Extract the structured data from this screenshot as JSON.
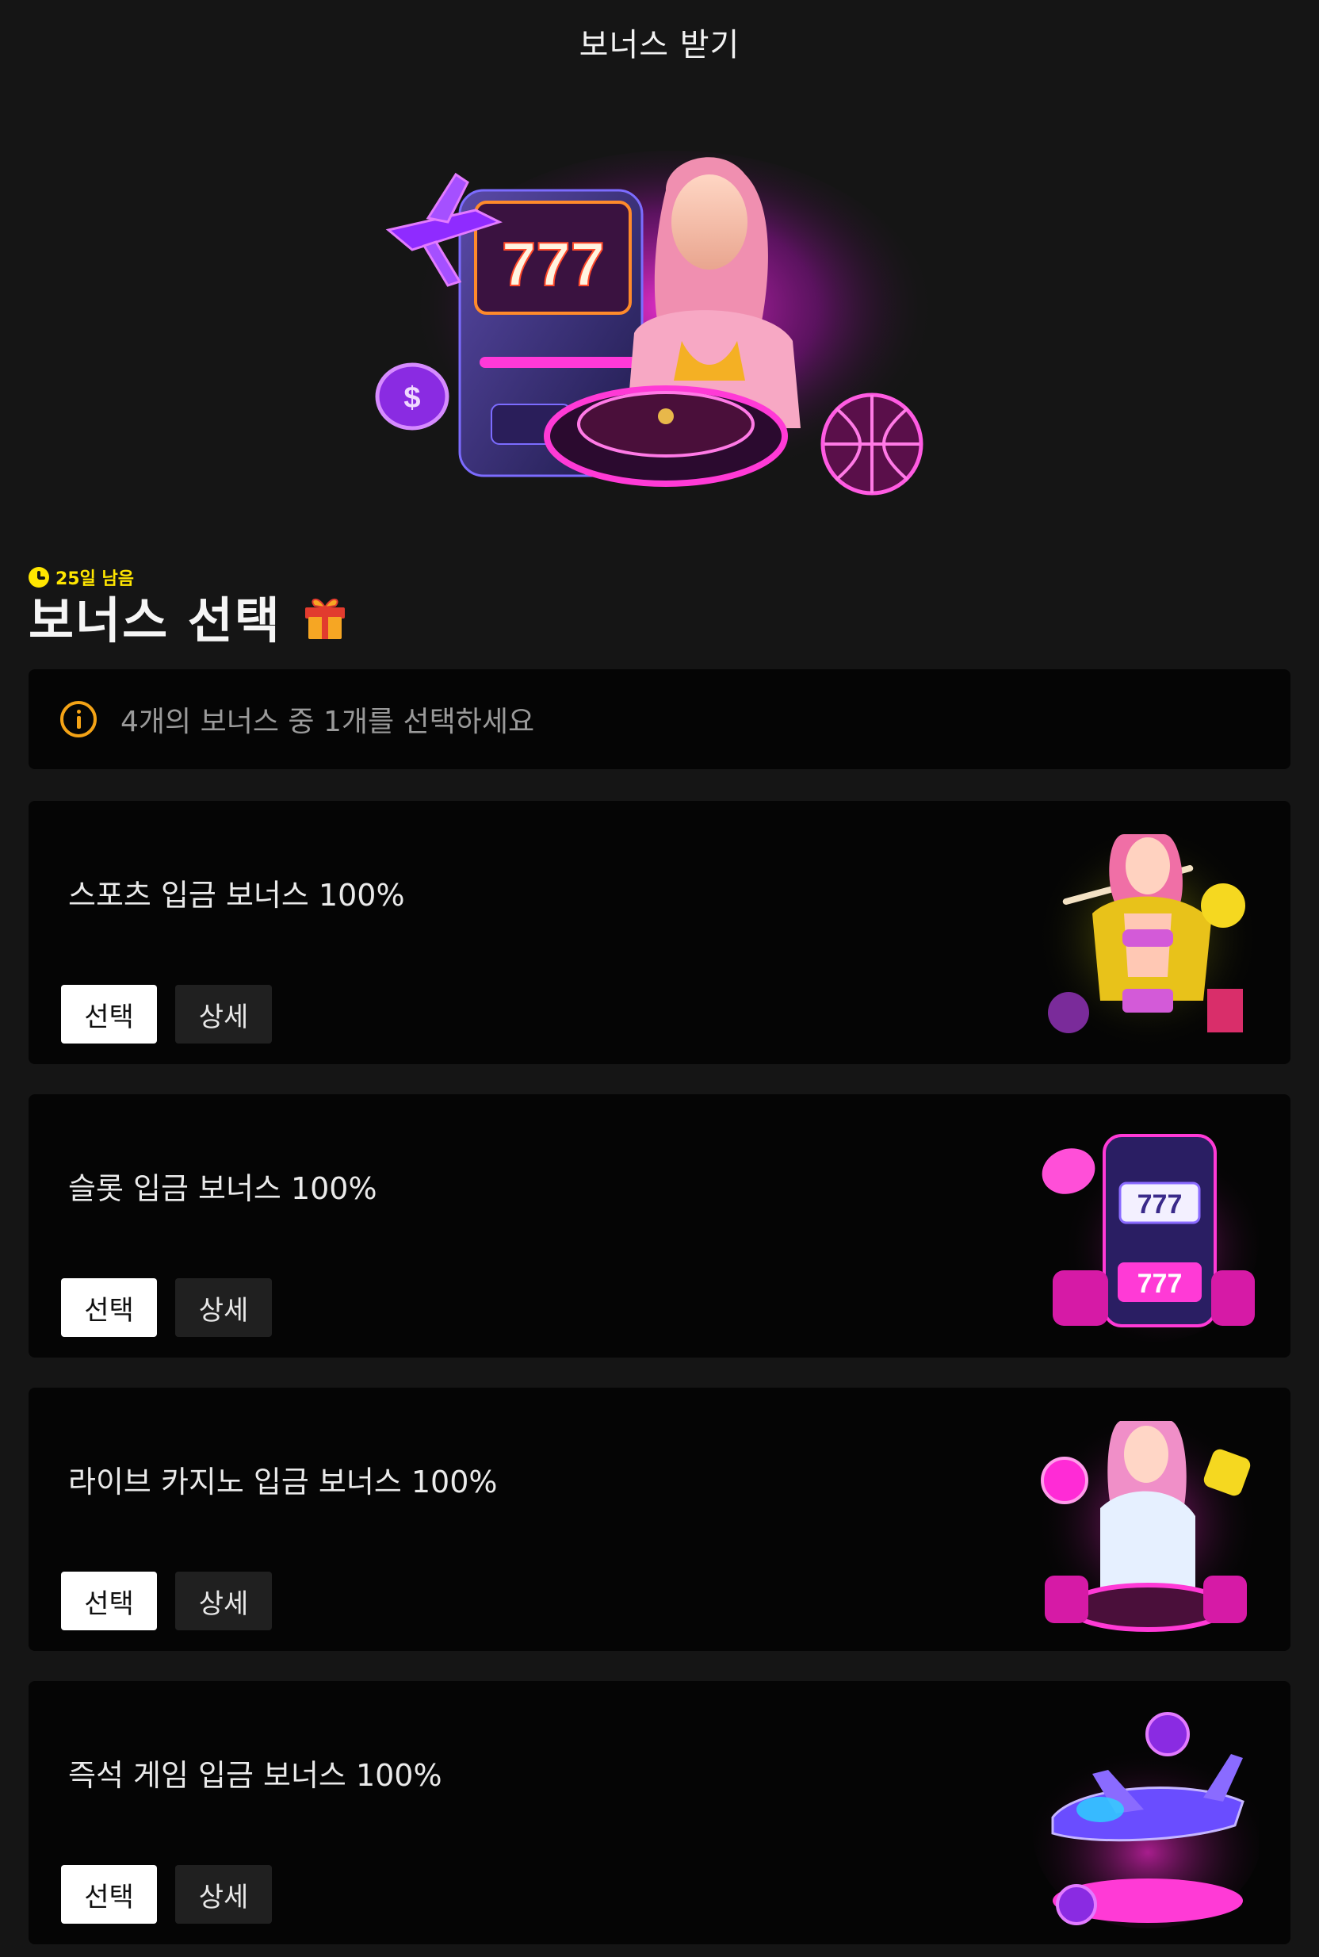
{
  "header": {
    "title": "보너스 받기"
  },
  "hero": {
    "image": "casino-hero-illustration",
    "slot_digits": "777"
  },
  "section": {
    "timer_text": "25일 남음",
    "title": "보너스 선택",
    "title_icon": "gift-icon"
  },
  "info": {
    "icon": "info-circle-icon",
    "text": "4개의 보너스 중 1개를 선택하세요"
  },
  "bonuses": [
    {
      "title": "스포츠 입금 보너스 100%",
      "select_label": "선택",
      "detail_label": "상세",
      "image": "sports-girl-illustration"
    },
    {
      "title": "슬롯 입금 보너스 100%",
      "select_label": "선택",
      "detail_label": "상세",
      "image": "slot-machine-illustration",
      "slot_digits": "777"
    },
    {
      "title": "라이브 카지노 입금 보너스 100%",
      "select_label": "선택",
      "detail_label": "상세",
      "image": "live-casino-girl-illustration"
    },
    {
      "title": "즉석 게임 입금 보너스 100%",
      "select_label": "선택",
      "detail_label": "상세",
      "image": "instant-game-airplane-illustration"
    }
  ],
  "colors": {
    "background": "#151515",
    "card": "#050505",
    "timer": "#ffe600",
    "info_icon": "#f4a316",
    "neon_pink": "#ff2bd6",
    "neon_purple": "#8a2be2"
  }
}
